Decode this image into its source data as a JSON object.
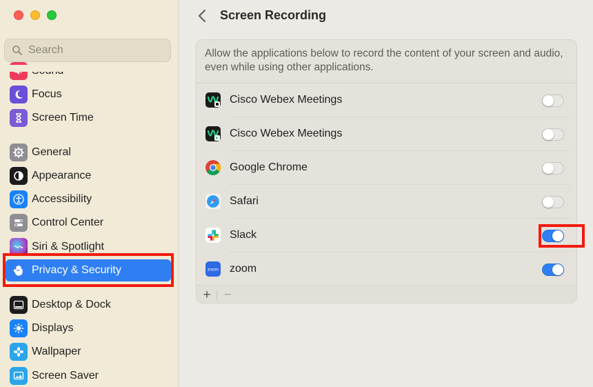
{
  "sidebar": {
    "search": {
      "placeholder": "Search"
    },
    "items": [
      {
        "label": "Sound",
        "icon": "sound-icon",
        "color": "#ee3b5c"
      },
      {
        "label": "Focus",
        "icon": "moon-icon",
        "color": "#6b4fd8"
      },
      {
        "label": "Screen Time",
        "icon": "hourglass-icon",
        "color": "#7b5bd6"
      },
      {
        "label": "General",
        "icon": "gear-icon",
        "color": "#8e8e93"
      },
      {
        "label": "Appearance",
        "icon": "appearance-icon",
        "color": "#1c1c1e"
      },
      {
        "label": "Accessibility",
        "icon": "accessibility-icon",
        "color": "#1a82f7"
      },
      {
        "label": "Control Center",
        "icon": "switches-icon",
        "color": "#8e8e93"
      },
      {
        "label": "Siri & Spotlight",
        "icon": "siri-icon",
        "color": "#b23fc9"
      },
      {
        "label": "Privacy & Security",
        "icon": "hand-icon",
        "color": "#2f7ff3",
        "selected": true
      },
      {
        "label": "Desktop & Dock",
        "icon": "dock-icon",
        "color": "#1c1c1e"
      },
      {
        "label": "Displays",
        "icon": "sun-icon",
        "color": "#1a82f7"
      },
      {
        "label": "Wallpaper",
        "icon": "flower-icon",
        "color": "#2ba5e8"
      },
      {
        "label": "Screen Saver",
        "icon": "screensaver-icon",
        "color": "#2ba5e8"
      }
    ]
  },
  "header": {
    "title": "Screen Recording"
  },
  "panel": {
    "description": "Allow the applications below to record the content of your screen and audio, even while using other applications.",
    "apps": [
      {
        "name": "Cisco Webex Meetings",
        "icon": "webex-icon",
        "enabled": false
      },
      {
        "name": "Cisco Webex Meetings",
        "icon": "webex-icon",
        "enabled": false
      },
      {
        "name": "Google Chrome",
        "icon": "chrome-icon",
        "enabled": false
      },
      {
        "name": "Safari",
        "icon": "safari-icon",
        "enabled": false
      },
      {
        "name": "Slack",
        "icon": "slack-icon",
        "enabled": true
      },
      {
        "name": "zoom",
        "icon": "zoom-icon",
        "enabled": true,
        "icon_text": "zoom"
      }
    ],
    "footer": {
      "add_label": "+",
      "remove_label": "−"
    }
  },
  "colors": {
    "accent": "#2f7ff3",
    "highlight": "#f21b0e",
    "sidebar_bg": "#f1ead7"
  }
}
